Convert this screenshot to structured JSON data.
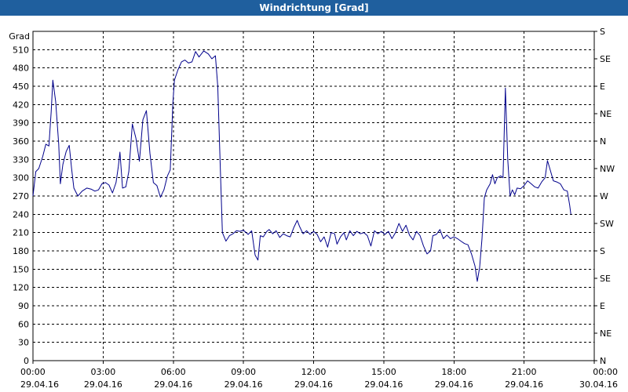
{
  "chart_data": {
    "type": "line",
    "title": "Windrichtung [Grad]",
    "ylabel": "Grad",
    "ylim": [
      0,
      540
    ],
    "y_ticks": [
      0,
      30,
      60,
      90,
      120,
      150,
      180,
      210,
      240,
      270,
      300,
      330,
      360,
      390,
      420,
      450,
      480,
      510
    ],
    "right_ticks": [
      {
        "value": 0,
        "label": "N"
      },
      {
        "value": 45,
        "label": "NE"
      },
      {
        "value": 90,
        "label": "E"
      },
      {
        "value": 135,
        "label": "SE"
      },
      {
        "value": 180,
        "label": "S"
      },
      {
        "value": 225,
        "label": "SW"
      },
      {
        "value": 270,
        "label": "W"
      },
      {
        "value": 315,
        "label": "NW"
      },
      {
        "value": 360,
        "label": "N"
      },
      {
        "value": 405,
        "label": "NE"
      },
      {
        "value": 450,
        "label": "E"
      },
      {
        "value": 495,
        "label": "SE"
      },
      {
        "value": 540,
        "label": "S"
      }
    ],
    "xlim": [
      0,
      24
    ],
    "x_ticks": [
      {
        "value": 0,
        "time": "00:00",
        "date": "29.04.16"
      },
      {
        "value": 3,
        "time": "03:00",
        "date": "29.04.16"
      },
      {
        "value": 6,
        "time": "06:00",
        "date": "29.04.16"
      },
      {
        "value": 9,
        "time": "09:00",
        "date": "29.04.16"
      },
      {
        "value": 12,
        "time": "12:00",
        "date": "29.04.16"
      },
      {
        "value": 15,
        "time": "15:00",
        "date": "29.04.16"
      },
      {
        "value": 18,
        "time": "18:00",
        "date": "29.04.16"
      },
      {
        "value": 21,
        "time": "21:00",
        "date": "29.04.16"
      },
      {
        "value": 24,
        "time": "00:00",
        "date": "30.04.16"
      }
    ],
    "grid": true,
    "series": [
      {
        "color": "#00008b",
        "points": [
          [
            0.0,
            270
          ],
          [
            0.12,
            310
          ],
          [
            0.25,
            315
          ],
          [
            0.42,
            335
          ],
          [
            0.55,
            355
          ],
          [
            0.68,
            352
          ],
          [
            0.78,
            408
          ],
          [
            0.85,
            460
          ],
          [
            0.97,
            425
          ],
          [
            1.1,
            355
          ],
          [
            1.17,
            290
          ],
          [
            1.28,
            322
          ],
          [
            1.42,
            343
          ],
          [
            1.55,
            353
          ],
          [
            1.65,
            315
          ],
          [
            1.75,
            283
          ],
          [
            1.92,
            270
          ],
          [
            2.1,
            278
          ],
          [
            2.3,
            283
          ],
          [
            2.5,
            281
          ],
          [
            2.65,
            278
          ],
          [
            2.8,
            280
          ],
          [
            2.95,
            290
          ],
          [
            3.1,
            292
          ],
          [
            3.25,
            288
          ],
          [
            3.4,
            275
          ],
          [
            3.55,
            292
          ],
          [
            3.65,
            318
          ],
          [
            3.72,
            342
          ],
          [
            3.83,
            283
          ],
          [
            3.97,
            285
          ],
          [
            4.1,
            310
          ],
          [
            4.25,
            388
          ],
          [
            4.4,
            365
          ],
          [
            4.55,
            327
          ],
          [
            4.7,
            395
          ],
          [
            4.85,
            410
          ],
          [
            5.0,
            340
          ],
          [
            5.15,
            292
          ],
          [
            5.3,
            287
          ],
          [
            5.45,
            268
          ],
          [
            5.6,
            280
          ],
          [
            5.75,
            303
          ],
          [
            5.87,
            313
          ],
          [
            5.98,
            422
          ],
          [
            6.05,
            460
          ],
          [
            6.2,
            477
          ],
          [
            6.35,
            490
          ],
          [
            6.5,
            493
          ],
          [
            6.65,
            488
          ],
          [
            6.8,
            490
          ],
          [
            6.95,
            507
          ],
          [
            7.1,
            498
          ],
          [
            7.3,
            508
          ],
          [
            7.5,
            503
          ],
          [
            7.65,
            495
          ],
          [
            7.8,
            500
          ],
          [
            7.9,
            450
          ],
          [
            8.0,
            330
          ],
          [
            8.1,
            210
          ],
          [
            8.25,
            196
          ],
          [
            8.4,
            205
          ],
          [
            8.55,
            208
          ],
          [
            8.7,
            213
          ],
          [
            8.85,
            212
          ],
          [
            9.0,
            214
          ],
          [
            9.2,
            207
          ],
          [
            9.35,
            213
          ],
          [
            9.5,
            173
          ],
          [
            9.62,
            165
          ],
          [
            9.72,
            205
          ],
          [
            9.85,
            203
          ],
          [
            10.0,
            212
          ],
          [
            10.1,
            215
          ],
          [
            10.25,
            208
          ],
          [
            10.4,
            213
          ],
          [
            10.55,
            202
          ],
          [
            10.7,
            208
          ],
          [
            10.85,
            205
          ],
          [
            11.0,
            203
          ],
          [
            11.15,
            218
          ],
          [
            11.3,
            230
          ],
          [
            11.4,
            220
          ],
          [
            11.55,
            208
          ],
          [
            11.7,
            213
          ],
          [
            11.85,
            207
          ],
          [
            12.0,
            212
          ],
          [
            12.15,
            207
          ],
          [
            12.3,
            195
          ],
          [
            12.45,
            203
          ],
          [
            12.6,
            186
          ],
          [
            12.75,
            210
          ],
          [
            12.9,
            208
          ],
          [
            13.0,
            191
          ],
          [
            13.15,
            203
          ],
          [
            13.3,
            210
          ],
          [
            13.4,
            198
          ],
          [
            13.55,
            213
          ],
          [
            13.7,
            205
          ],
          [
            13.85,
            212
          ],
          [
            14.0,
            208
          ],
          [
            14.15,
            210
          ],
          [
            14.3,
            205
          ],
          [
            14.45,
            188
          ],
          [
            14.6,
            213
          ],
          [
            14.75,
            208
          ],
          [
            14.9,
            212
          ],
          [
            15.05,
            207
          ],
          [
            15.2,
            212
          ],
          [
            15.35,
            200
          ],
          [
            15.5,
            210
          ],
          [
            15.65,
            225
          ],
          [
            15.8,
            212
          ],
          [
            15.95,
            222
          ],
          [
            16.1,
            206
          ],
          [
            16.25,
            198
          ],
          [
            16.4,
            212
          ],
          [
            16.55,
            205
          ],
          [
            16.7,
            188
          ],
          [
            16.85,
            175
          ],
          [
            17.0,
            180
          ],
          [
            17.1,
            205
          ],
          [
            17.25,
            207
          ],
          [
            17.4,
            215
          ],
          [
            17.55,
            200
          ],
          [
            17.7,
            206
          ],
          [
            17.85,
            200
          ],
          [
            18.0,
            203
          ],
          [
            18.15,
            200
          ],
          [
            18.3,
            196
          ],
          [
            18.45,
            192
          ],
          [
            18.6,
            190
          ],
          [
            18.75,
            175
          ],
          [
            18.9,
            155
          ],
          [
            19.0,
            130
          ],
          [
            19.1,
            153
          ],
          [
            19.2,
            200
          ],
          [
            19.3,
            267
          ],
          [
            19.4,
            280
          ],
          [
            19.55,
            290
          ],
          [
            19.65,
            305
          ],
          [
            19.75,
            290
          ],
          [
            19.85,
            300
          ],
          [
            20.0,
            303
          ],
          [
            20.1,
            300
          ],
          [
            20.2,
            447
          ],
          [
            20.3,
            330
          ],
          [
            20.4,
            270
          ],
          [
            20.5,
            280
          ],
          [
            20.6,
            272
          ],
          [
            20.7,
            283
          ],
          [
            20.85,
            282
          ],
          [
            21.0,
            287
          ],
          [
            21.15,
            295
          ],
          [
            21.3,
            290
          ],
          [
            21.45,
            285
          ],
          [
            21.6,
            283
          ],
          [
            21.75,
            293
          ],
          [
            21.9,
            300
          ],
          [
            22.0,
            328
          ],
          [
            22.1,
            315
          ],
          [
            22.25,
            295
          ],
          [
            22.4,
            293
          ],
          [
            22.55,
            290
          ],
          [
            22.7,
            280
          ],
          [
            22.85,
            278
          ],
          [
            22.95,
            255
          ],
          [
            23.0,
            240
          ]
        ]
      }
    ]
  }
}
